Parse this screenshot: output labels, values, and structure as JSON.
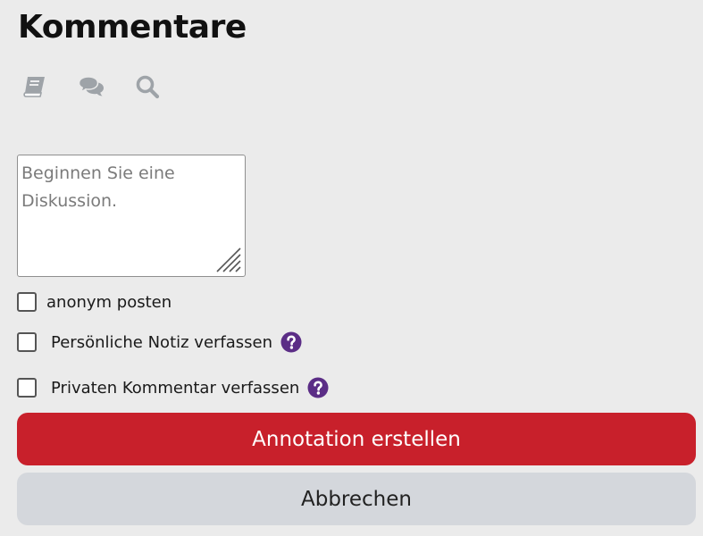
{
  "header": {
    "title": "Kommentare"
  },
  "toolbar": {
    "icons": [
      "book-icon",
      "comments-icon",
      "search-icon"
    ]
  },
  "comment_box": {
    "value": "",
    "placeholder": "Beginnen Sie eine Diskussion."
  },
  "options": {
    "anonymous": {
      "label": "anonym posten",
      "checked": false
    },
    "personal_note": {
      "label": "Persönliche Notiz verfassen",
      "checked": false,
      "help_icon": "question-circle-icon"
    },
    "private_comment": {
      "label": "Privaten Kommentar verfassen",
      "checked": false,
      "help_icon": "question-circle-icon"
    }
  },
  "actions": {
    "submit_label": "Annotation erstellen",
    "cancel_label": "Abbrechen"
  },
  "colors": {
    "background": "#ebebeb",
    "primary": "#c8202b",
    "secondary": "#d4d7dc",
    "help_icon": "#5b2d86",
    "toolbar_icon": "#9ea3a8"
  }
}
